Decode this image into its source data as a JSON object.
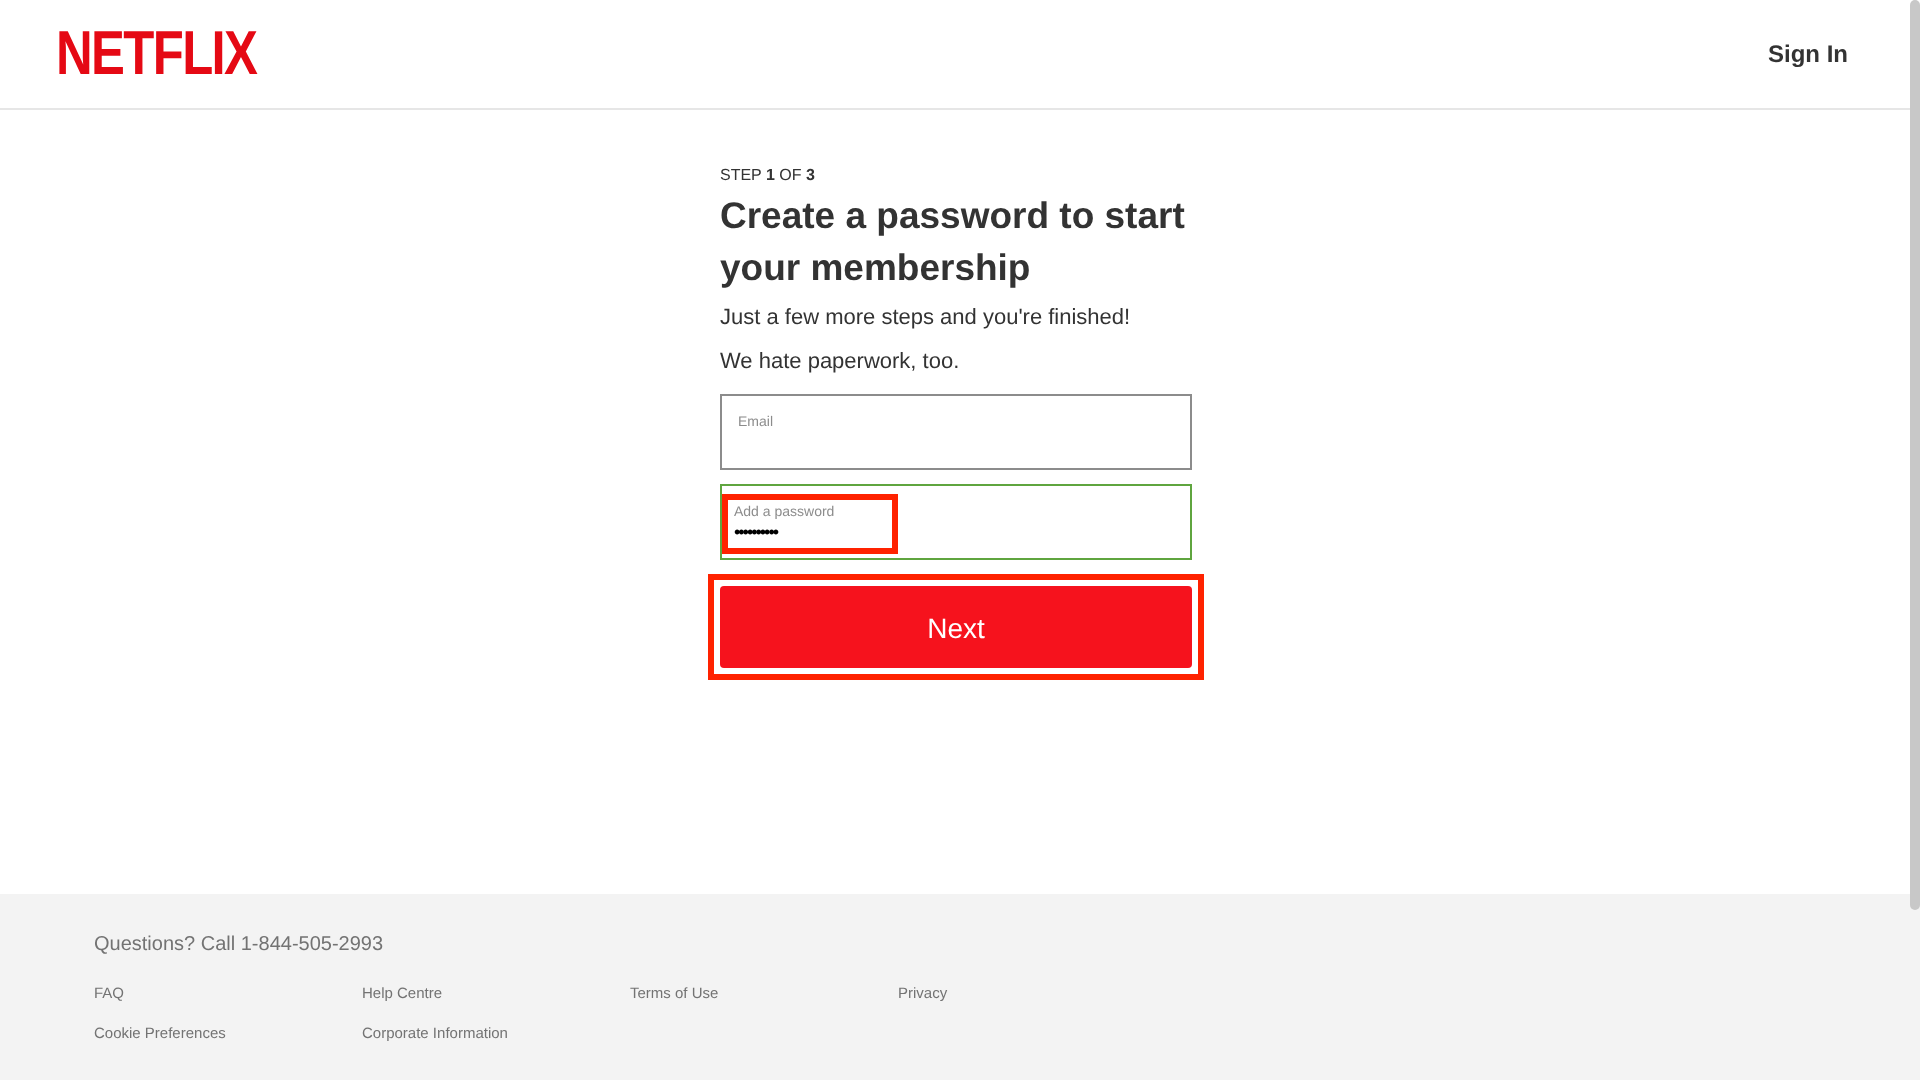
{
  "header": {
    "logo": "NETFLIX",
    "sign_in": "Sign In"
  },
  "form": {
    "step": "STEP **1** OF **3**",
    "title": "Create a password to start your membership",
    "lines": [
      "Just a few more steps and you're finished!",
      "We hate paperwork, too."
    ],
    "fields": [
      {
        "placeholder": "Email",
        "valid": false,
        "highlighted": false
      },
      {
        "placeholder": "Add a password",
        "value": "••••••••••",
        "valid": true,
        "highlighted": true
      }
    ],
    "button": {
      "label": "Next",
      "highlighted": true
    }
  },
  "footer": {
    "contact": "Questions? Call 1-844-505-2993",
    "links": [
      [
        "FAQ",
        "Cookie Preferences"
      ],
      [
        "Help Centre",
        "Corporate Information"
      ],
      [
        "Terms of Use"
      ],
      [
        "Privacy"
      ]
    ]
  }
}
